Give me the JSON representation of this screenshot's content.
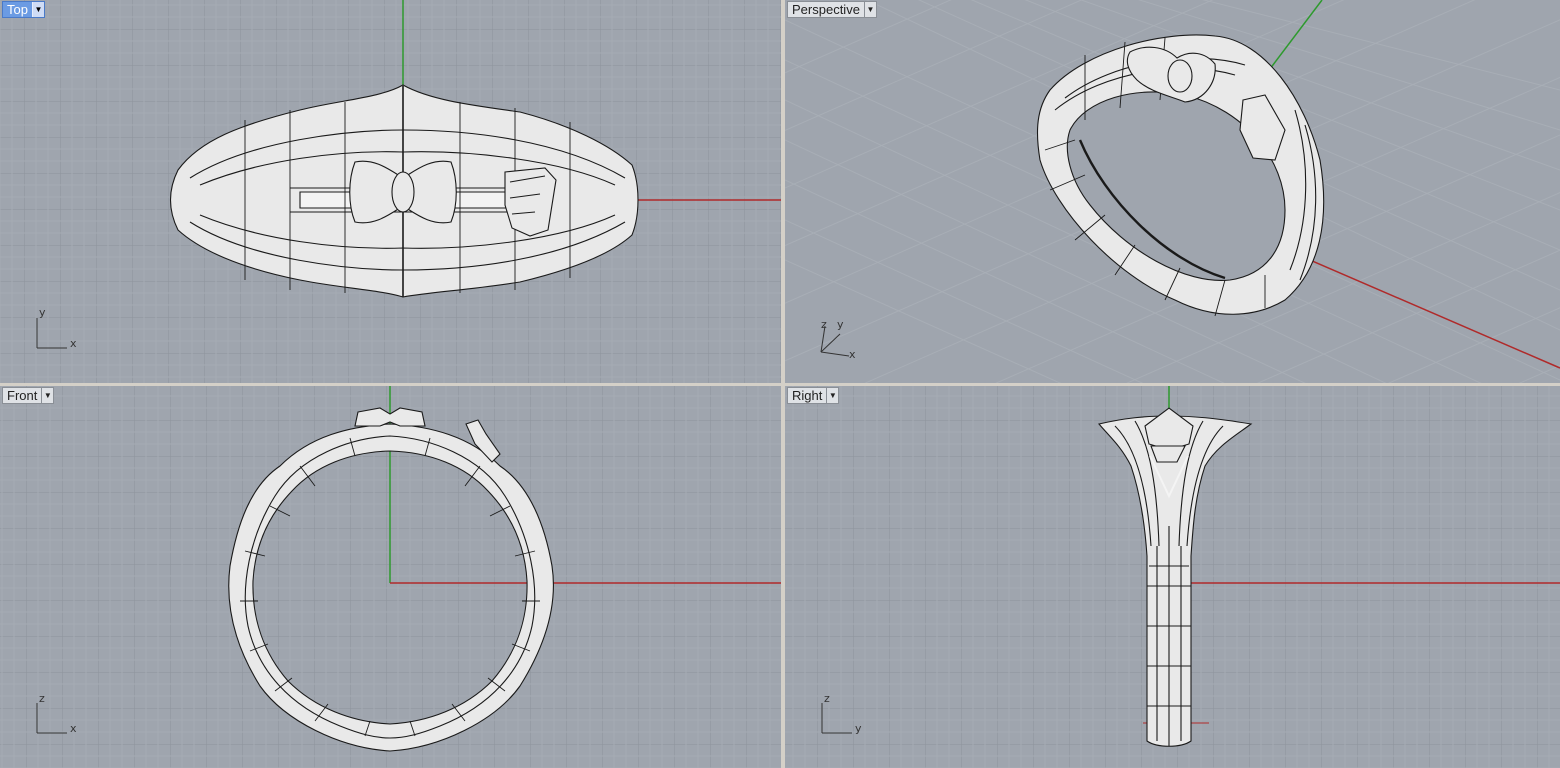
{
  "viewports": [
    {
      "id": "top",
      "label": "Top",
      "active": true,
      "axis_labels": {
        "v": "y",
        "h": "x"
      }
    },
    {
      "id": "perspective",
      "label": "Perspective",
      "active": false,
      "axis_labels": {
        "v": "z",
        "v2": "y",
        "h": "x"
      }
    },
    {
      "id": "front",
      "label": "Front",
      "active": false,
      "axis_labels": {
        "v": "z",
        "h": "x"
      }
    },
    {
      "id": "right",
      "label": "Right",
      "active": false,
      "axis_labels": {
        "v": "z",
        "h": "y"
      }
    }
  ],
  "icons": {
    "viewport_menu": "chevron-down-icon"
  },
  "colors": {
    "viewport_bg": "#9fa5ae",
    "grid_minor": "#a8aeb6",
    "grid_major": "#8e949c",
    "x_axis": "#b02a2a",
    "y_axis": "#2e9a2e",
    "model_fill": "#e9e9e9",
    "model_stroke": "#1a1a1a",
    "active_tab": "#6b9be3"
  }
}
